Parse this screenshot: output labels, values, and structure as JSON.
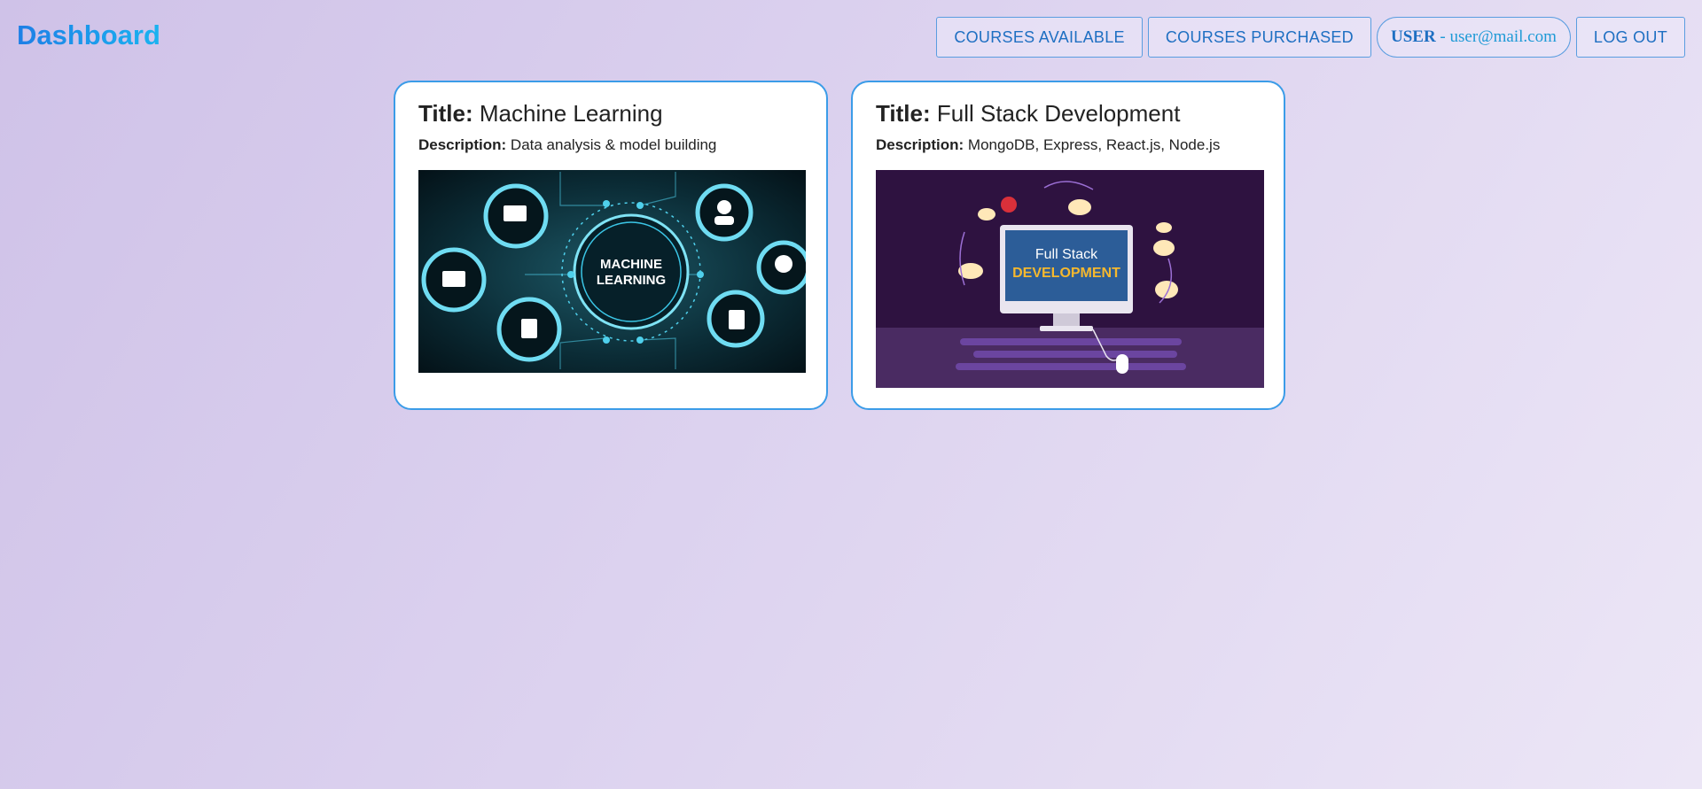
{
  "header": {
    "brand": "Dashboard",
    "nav": {
      "courses_available": "COURSES AVAILABLE",
      "courses_purchased": "COURSES PURCHASED",
      "user_label": "USER",
      "user_separator": " - ",
      "user_email": "user@mail.com",
      "logout": "LOG OUT"
    }
  },
  "courses": [
    {
      "title_label": "Title:",
      "title": "Machine Learning",
      "description_label": "Description:",
      "description": "Data analysis & model building",
      "image_text_line1": "MACHINE",
      "image_text_line2": "LEARNING"
    },
    {
      "title_label": "Title:",
      "title": "Full Stack Development",
      "description_label": "Description:",
      "description": "MongoDB, Express, React.js, Node.js",
      "image_text_line1": "Full Stack",
      "image_text_line2": "DEVELOPMENT"
    }
  ],
  "colors": {
    "accent": "#3b9ce8",
    "nav_text": "#1e6fc2",
    "ml_bg": "#0a2830",
    "fs_bg": "#2e1240",
    "fs_title_accent": "#f5b82e"
  }
}
